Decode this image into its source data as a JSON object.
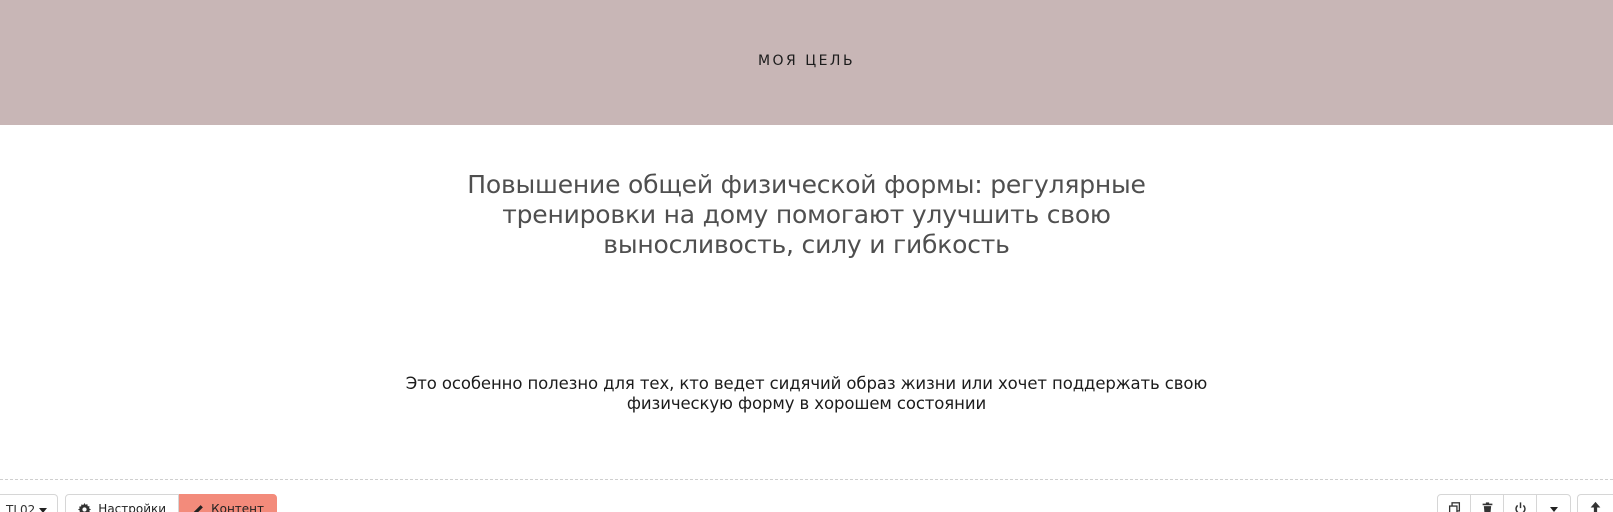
{
  "banner": {
    "title": "МОЯ ЦЕЛЬ",
    "background": "#c8b6b6"
  },
  "main": {
    "headline": "Повышение общей физической формы: регулярные тренировки на дому помогают улучшить свою выносливость, силу и гибкость",
    "body": "Это особенно полезно для тех, кто ведет сидячий образ жизни или хочет поддержать свою физическую форму в хорошем состоянии"
  },
  "toolbar": {
    "block_id": "TL02",
    "settings_label": "Настройки",
    "content_label": "Контент",
    "accent": "#f38b7b",
    "icons": {
      "settings": "gear-icon",
      "content": "pencil-icon",
      "duplicate": "copy-icon",
      "delete": "trash-icon",
      "toggle": "power-icon",
      "more": "chevron-down-icon",
      "move_up": "arrow-up-icon"
    }
  }
}
